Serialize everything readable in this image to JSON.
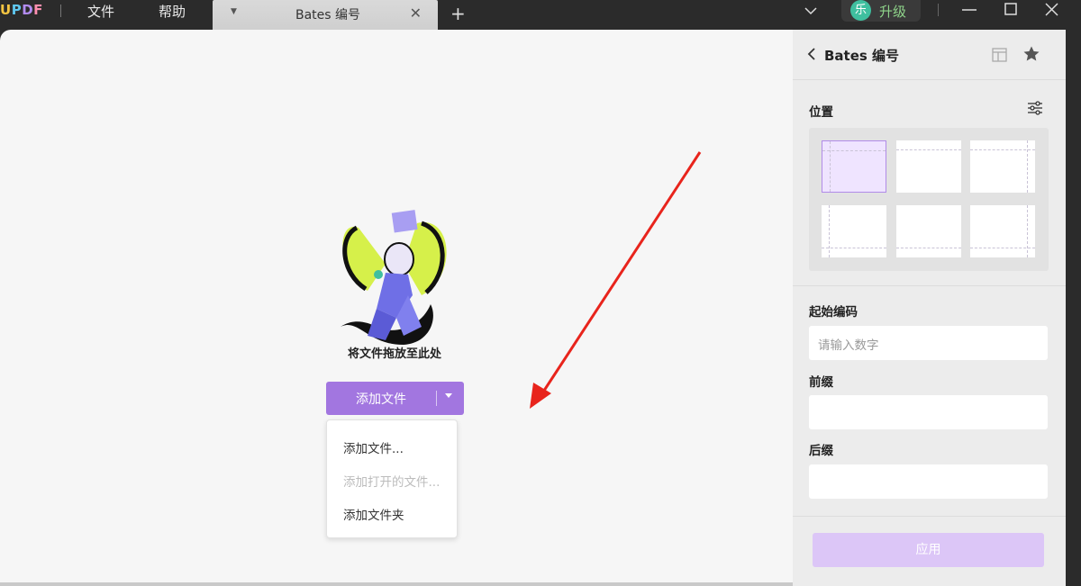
{
  "app": {
    "logo": "UPDF",
    "menu": [
      "文件",
      "帮助"
    ],
    "tab_title": "Bates 编号",
    "upgrade_avatar": "乐",
    "upgrade_label": "升级"
  },
  "main": {
    "drop_label": "将文件拖放至此处",
    "add_button": "添加文件",
    "dropdown": [
      {
        "label": "添加文件...",
        "disabled": false
      },
      {
        "label": "添加打开的文件...",
        "disabled": true
      },
      {
        "label": "添加文件夹",
        "disabled": false
      }
    ]
  },
  "panel": {
    "title": "Bates 编号",
    "position_label": "位置",
    "start_label": "起始编码",
    "start_placeholder": "请输入数字",
    "prefix_label": "前缀",
    "suffix_label": "后缀",
    "apply_label": "应用"
  },
  "colors": {
    "accent": "#a276e0",
    "apply_disabled": "#dcc6f7",
    "annotation_arrow": "#e8241c"
  }
}
